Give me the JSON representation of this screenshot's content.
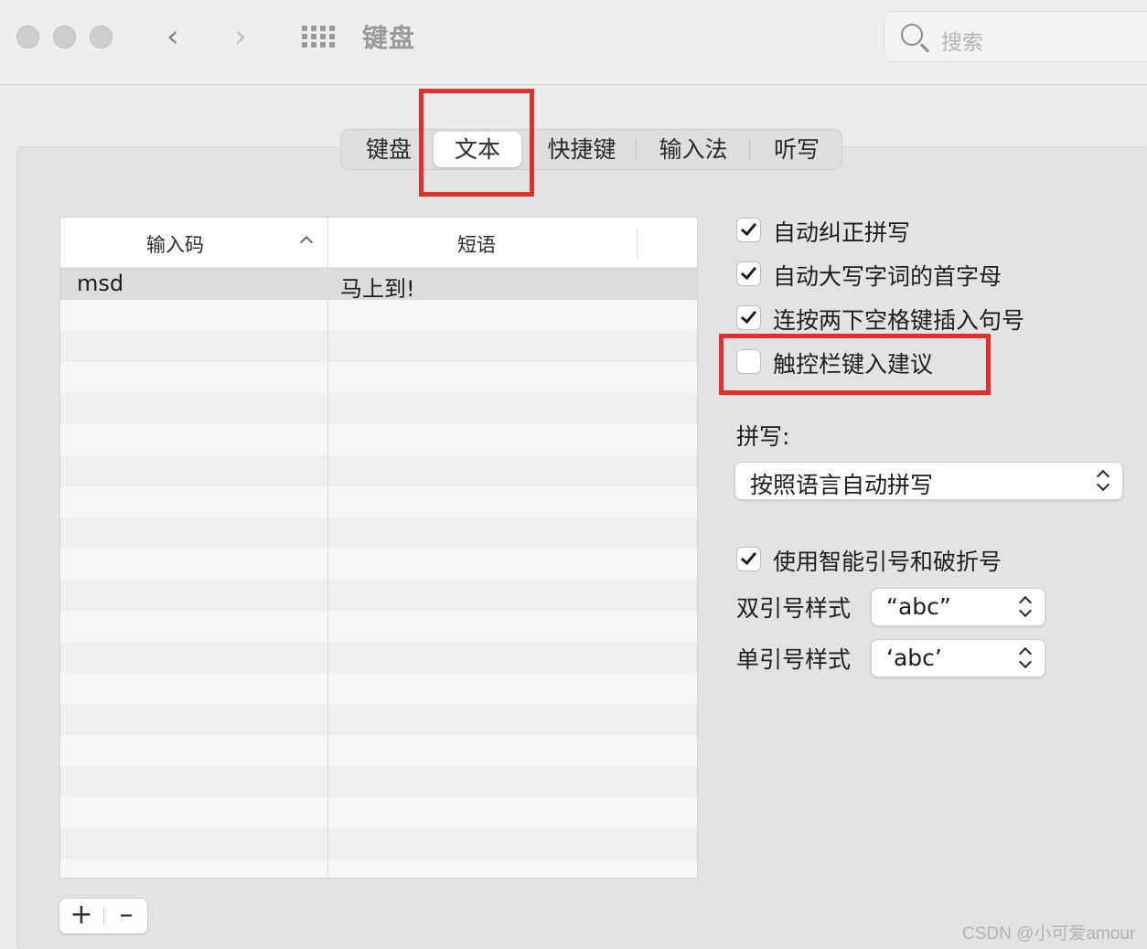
{
  "window": {
    "title": "键盘"
  },
  "search": {
    "placeholder": "搜索"
  },
  "tabs": [
    {
      "label": "键盘",
      "selected": false
    },
    {
      "label": "文本",
      "selected": true
    },
    {
      "label": "快捷键",
      "selected": false
    },
    {
      "label": "输入法",
      "selected": false
    },
    {
      "label": "听写",
      "selected": false
    }
  ],
  "table": {
    "headers": {
      "input_code": "输入码",
      "phrase": "短语"
    },
    "rows": [
      {
        "input_code": "msd",
        "phrase": "马上到!"
      }
    ]
  },
  "buttons": {
    "add": "+",
    "remove": "–"
  },
  "options": [
    {
      "label": "自动纠正拼写",
      "checked": true
    },
    {
      "label": "自动大写字词的首字母",
      "checked": true
    },
    {
      "label": "连按两下空格键插入句号",
      "checked": true
    },
    {
      "label": "触控栏键入建议",
      "checked": false
    }
  ],
  "spelling": {
    "label": "拼写:",
    "value": "按照语言自动拼写"
  },
  "smart_quotes": {
    "label": "使用智能引号和破折号",
    "checked": true
  },
  "double_quote": {
    "label": "双引号样式",
    "value": "“abc”"
  },
  "single_quote": {
    "label": "单引号样式",
    "value": "‘abc’"
  },
  "watermark": "CSDN @小可爱amour",
  "colors": {
    "highlight": "#e0302a",
    "window_bg": "#ecebec"
  }
}
